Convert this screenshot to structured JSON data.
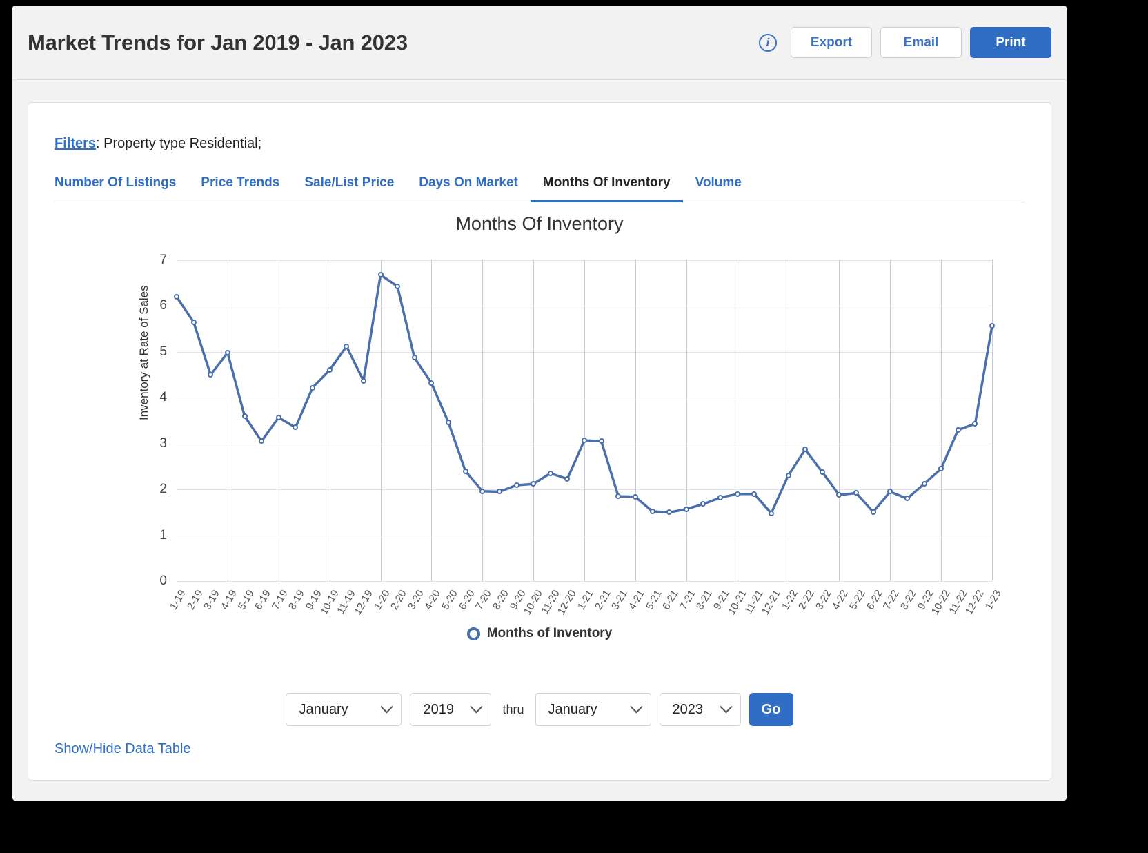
{
  "header": {
    "title": "Market Trends for Jan 2019 - Jan 2023",
    "info_icon": "info-icon",
    "buttons": [
      {
        "label": "Export",
        "style": "secondary"
      },
      {
        "label": "Email",
        "style": "secondary"
      },
      {
        "label": "Print",
        "style": "primary"
      }
    ]
  },
  "filters": {
    "link_label": "Filters",
    "text": ": Property type Residential;"
  },
  "tabs": [
    {
      "label": "Number Of Listings",
      "active": false
    },
    {
      "label": "Price Trends",
      "active": false
    },
    {
      "label": "Sale/List Price",
      "active": false
    },
    {
      "label": "Days On Market",
      "active": false
    },
    {
      "label": "Months Of Inventory",
      "active": true
    },
    {
      "label": "Volume",
      "active": false
    }
  ],
  "legend": {
    "label": "Months of Inventory",
    "marker_color": "#4a6fab"
  },
  "controls": {
    "start_month": "January",
    "start_year": "2019",
    "thru": "thru",
    "end_month": "January",
    "end_year": "2023",
    "go_label": "Go"
  },
  "footer": {
    "data_table_toggle": "Show/Hide Data Table"
  },
  "colors": {
    "accent": "#2f6ec4",
    "link": "#3b72c4",
    "series": "#4a6fab",
    "grid": "#e3e3e3",
    "vgrid": "#c3ccd8"
  },
  "chart_data": {
    "type": "line",
    "title": "Months Of Inventory",
    "xlabel": "",
    "ylabel": "Inventory at Rate of Sales",
    "ylim": [
      0,
      7
    ],
    "yticks": [
      0,
      1,
      2,
      3,
      4,
      5,
      6,
      7
    ],
    "grid": true,
    "legend_position": "bottom",
    "categories": [
      "1-19",
      "2-19",
      "3-19",
      "4-19",
      "5-19",
      "6-19",
      "7-19",
      "8-19",
      "9-19",
      "10-19",
      "11-19",
      "12-19",
      "1-20",
      "2-20",
      "3-20",
      "4-20",
      "5-20",
      "6-20",
      "7-20",
      "8-20",
      "9-20",
      "10-20",
      "11-20",
      "12-20",
      "1-21",
      "2-21",
      "3-21",
      "4-21",
      "5-21",
      "6-21",
      "7-21",
      "8-21",
      "9-21",
      "10-21",
      "11-21",
      "12-21",
      "1-22",
      "2-22",
      "3-22",
      "4-22",
      "5-22",
      "6-22",
      "7-22",
      "8-22",
      "9-22",
      "10-22",
      "11-22",
      "12-22",
      "1-23"
    ],
    "series": [
      {
        "name": "Months of Inventory",
        "color": "#4a6fab",
        "values": [
          6.2,
          5.65,
          4.5,
          4.98,
          3.6,
          3.05,
          3.57,
          3.35,
          4.22,
          4.6,
          5.12,
          4.37,
          6.68,
          6.43,
          4.87,
          4.32,
          3.46,
          2.4,
          1.96,
          1.95,
          2.09,
          2.12,
          2.35,
          2.23,
          3.07,
          3.05,
          1.85,
          1.84,
          1.52,
          1.5,
          1.57,
          1.68,
          1.82,
          1.9,
          1.9,
          1.48,
          2.3,
          2.87,
          2.38,
          1.88,
          1.92,
          1.51,
          1.95,
          1.8,
          2.12,
          2.45,
          3.3,
          3.43,
          5.57
        ]
      }
    ]
  }
}
